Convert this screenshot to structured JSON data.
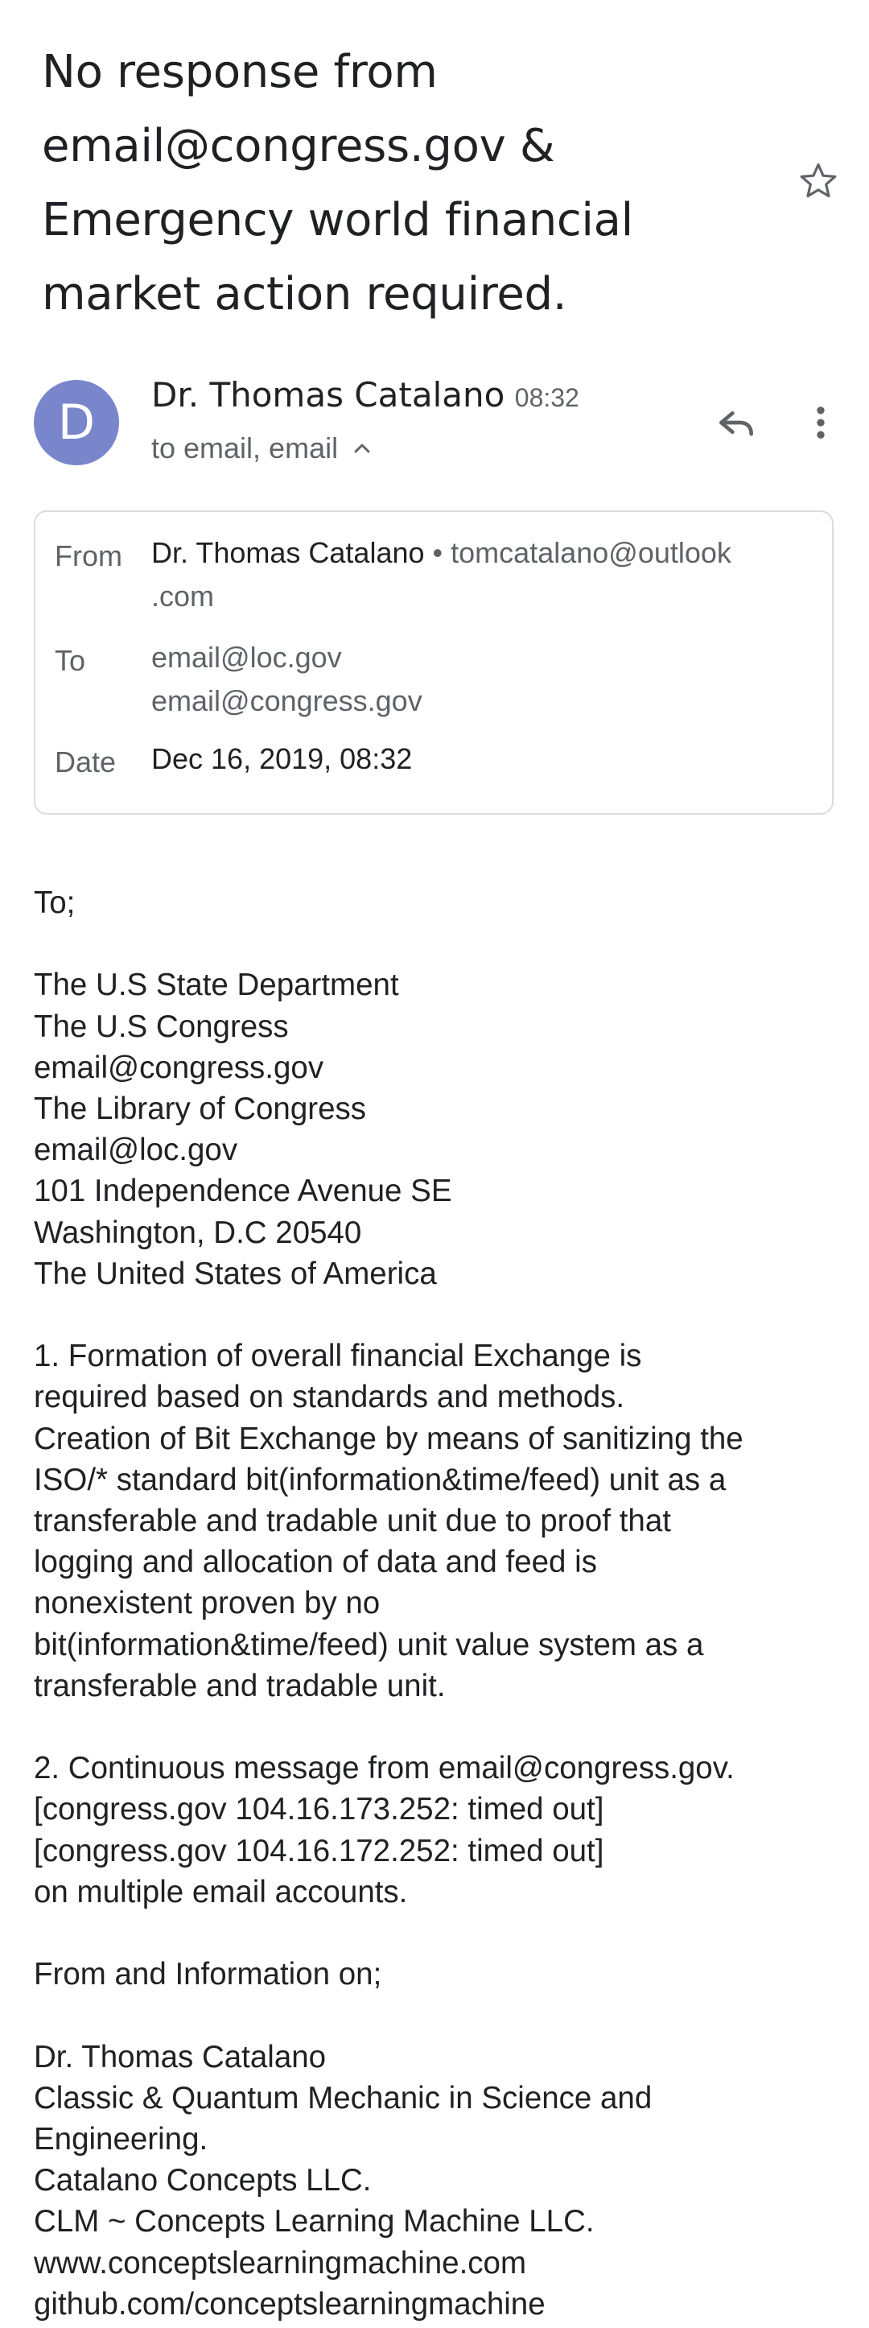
{
  "subject": {
    "lines": [
      "No response from",
      "email@congress.gov &",
      "Emergency world financial",
      "market action required."
    ]
  },
  "header": {
    "avatar_letter": "D",
    "avatar_color": "#7986cb",
    "sender_name": "Dr. Thomas Catalano",
    "time": "08:32",
    "recipients_summary": "to email, email",
    "icons": {
      "star": "star-outline-icon",
      "reply": "reply-icon",
      "more": "more-vert-icon",
      "expand": "chevron-up-icon"
    }
  },
  "details": {
    "from_label": "From",
    "from_name": "Dr. Thomas Catalano",
    "from_separator": "•",
    "from_email_line1": "tomcatalano@outlook",
    "from_email_line2": ".com",
    "to_label": "To",
    "to_addresses": [
      "email@loc.gov",
      "email@congress.gov"
    ],
    "date_label": "Date",
    "date_value": "Dec 16, 2019, 08:32"
  },
  "body": {
    "greeting": "To;",
    "address_lines": [
      "The U.S State Department",
      "The U.S Congress",
      "email@congress.gov",
      "The Library of Congress",
      "email@loc.gov",
      "101 Independence Avenue SE",
      "Washington, D.C 20540",
      "The United States of America"
    ],
    "point1_lines": [
      "1. Formation of overall financial Exchange is",
      "required based on standards and methods.",
      "Creation of Bit Exchange by means of sanitizing the",
      "ISO/* standard bit(information&time/feed) unit as a",
      "transferable and tradable unit due to proof that",
      "logging and allocation of data and feed is",
      "nonexistent proven by no",
      "bit(information&time/feed) unit value system as a",
      "transferable and tradable unit."
    ],
    "point2_lines": [
      "2. Continuous message from email@congress.gov.",
      "[congress.gov 104.16.173.252: timed out]",
      "[congress.gov 104.16.172.252: timed out]",
      "on multiple email accounts."
    ],
    "from_info": "From and Information on;",
    "signature_lines": [
      "Dr. Thomas Catalano",
      "Classic & Quantum Mechanic in Science and",
      "Engineering.",
      "Catalano Concepts LLC.",
      "CLM ~ Concepts Learning Machine LLC.",
      "www.conceptslearningmachine.com",
      "github.com/conceptslearningmachine"
    ]
  }
}
